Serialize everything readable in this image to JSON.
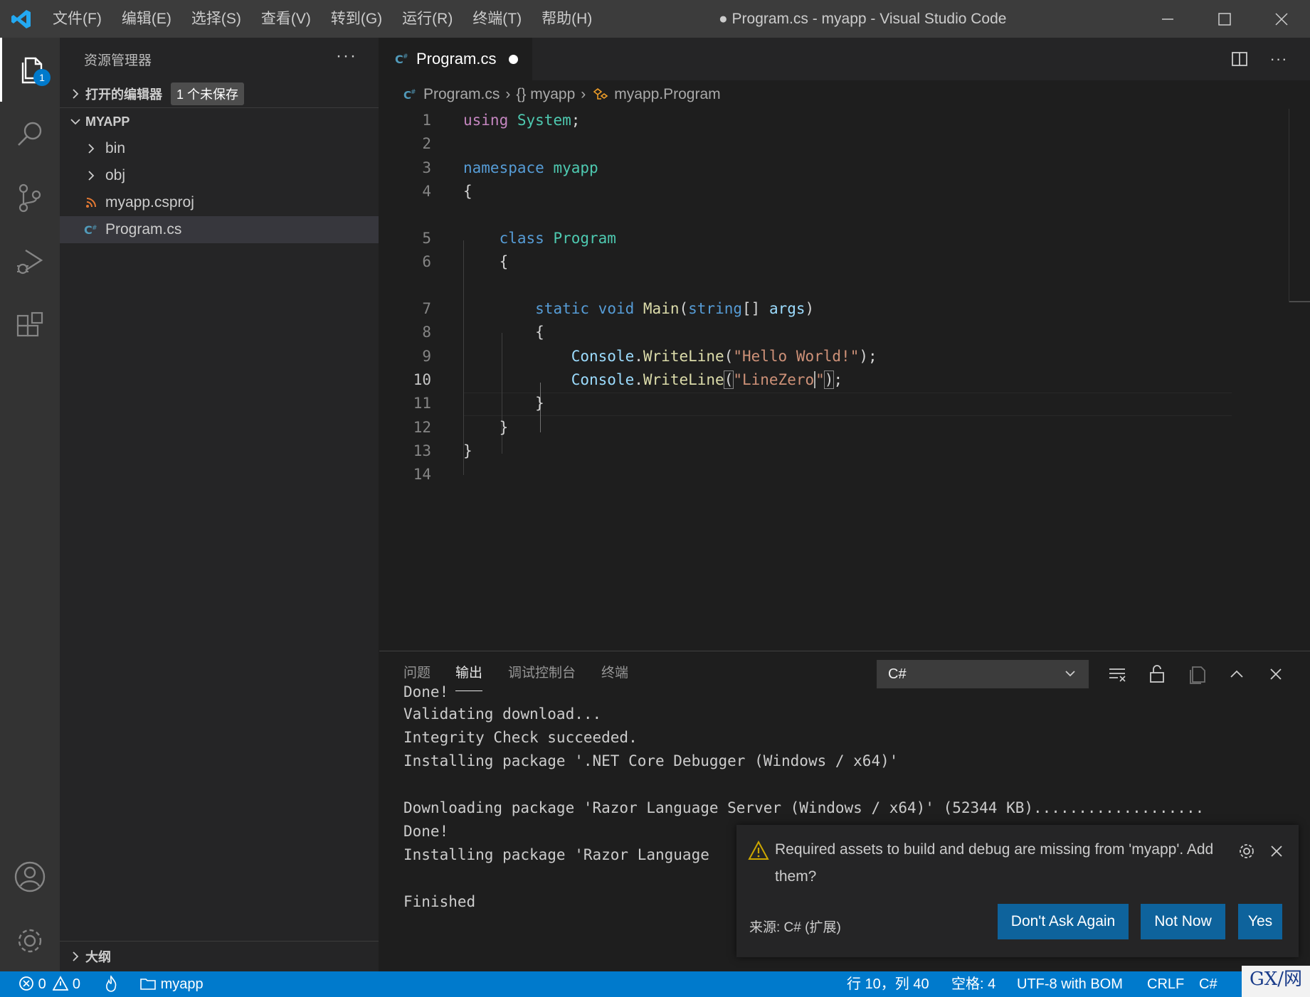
{
  "titlebar": {
    "menus": [
      "文件(F)",
      "编辑(E)",
      "选择(S)",
      "查看(V)",
      "转到(G)",
      "运行(R)",
      "终端(T)",
      "帮助(H)"
    ],
    "title": "● Program.cs - myapp - Visual Studio Code"
  },
  "activitybar": {
    "explorer_badge": "1"
  },
  "sidebar": {
    "header": "资源管理器",
    "open_editors": "打开的编辑器",
    "unsaved_badge": "1 个未保存",
    "project": "MYAPP",
    "items": [
      {
        "label": "bin",
        "kind": "folder"
      },
      {
        "label": "obj",
        "kind": "folder"
      },
      {
        "label": "myapp.csproj",
        "kind": "rss-file"
      },
      {
        "label": "Program.cs",
        "kind": "csharp-file"
      }
    ],
    "outline": "大纲"
  },
  "editor": {
    "tab": "Program.cs",
    "breadcrumb": [
      "Program.cs",
      "{} myapp",
      "myapp.Program"
    ],
    "line_numbers": [
      "1",
      "2",
      "3",
      "4",
      "5",
      "6",
      "7",
      "8",
      "9",
      "10",
      "11",
      "12",
      "13",
      "14"
    ],
    "current_line": "10"
  },
  "panel": {
    "tabs": [
      "问题",
      "输出",
      "调试控制台",
      "终端"
    ],
    "active_tab": "输出",
    "channel": "C#",
    "output": [
      "Done!",
      "Validating download...",
      "Integrity Check succeeded.",
      "Installing package '.NET Core Debugger (Windows / x64)'",
      "",
      "Downloading package 'Razor Language Server (Windows / x64)' (52344 KB)...................",
      "Done!",
      "Installing package 'Razor Language",
      "",
      "Finished"
    ]
  },
  "notification": {
    "message": "Required assets to build and debug are missing from 'myapp'. Add them?",
    "source": "来源: C# (扩展)",
    "buttons": [
      "Don't Ask Again",
      "Not Now",
      "Yes"
    ]
  },
  "statusbar": {
    "errors": "0",
    "warnings": "0",
    "folder": "myapp",
    "position": "行 10，列 40",
    "indent": "空格: 4",
    "encoding": "UTF-8 with BOM",
    "eol": "CRLF",
    "language": "C#"
  },
  "watermark": "GX/网"
}
